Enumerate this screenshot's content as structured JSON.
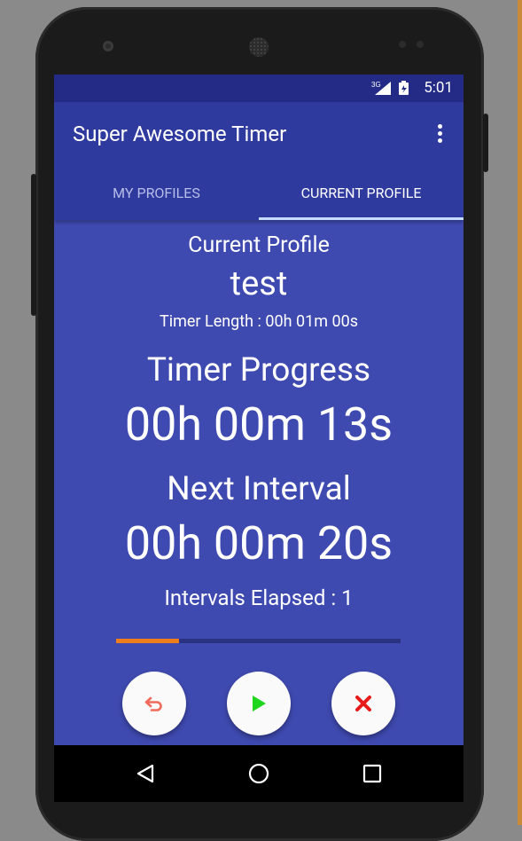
{
  "status_bar": {
    "network": "3G",
    "time": "5:01"
  },
  "app_bar": {
    "title": "Super Awesome Timer",
    "menu_icon": "more-vert-icon"
  },
  "tabs": [
    {
      "label": "MY PROFILES",
      "selected": false
    },
    {
      "label": "CURRENT PROFILE",
      "selected": true
    }
  ],
  "profile": {
    "section_label": "Current Profile",
    "name": "test",
    "timer_length": "Timer Length : 00h 01m 00s"
  },
  "timer": {
    "progress_label": "Timer Progress",
    "progress_value": "00h 00m 13s",
    "next_interval_label": "Next Interval",
    "next_interval_value": "00h 00m 20s",
    "intervals_elapsed": "Intervals Elapsed : 1",
    "progress_fraction": 0.22
  },
  "controls": {
    "reset_icon": "undo-icon",
    "play_icon": "play-icon",
    "stop_icon": "close-icon"
  },
  "nav_bar": {
    "back_icon": "back-triangle-icon",
    "home_icon": "home-circle-icon",
    "recents_icon": "recents-square-icon"
  },
  "colors": {
    "status_bar": "#232b86",
    "app_bar": "#2f3a9e",
    "content_bg": "#3f4ab0",
    "progress_accent": "#ef7d1a",
    "reset_icon": "#f06a5a",
    "play_icon": "#1ed61e",
    "stop_icon": "#e81a1a"
  }
}
